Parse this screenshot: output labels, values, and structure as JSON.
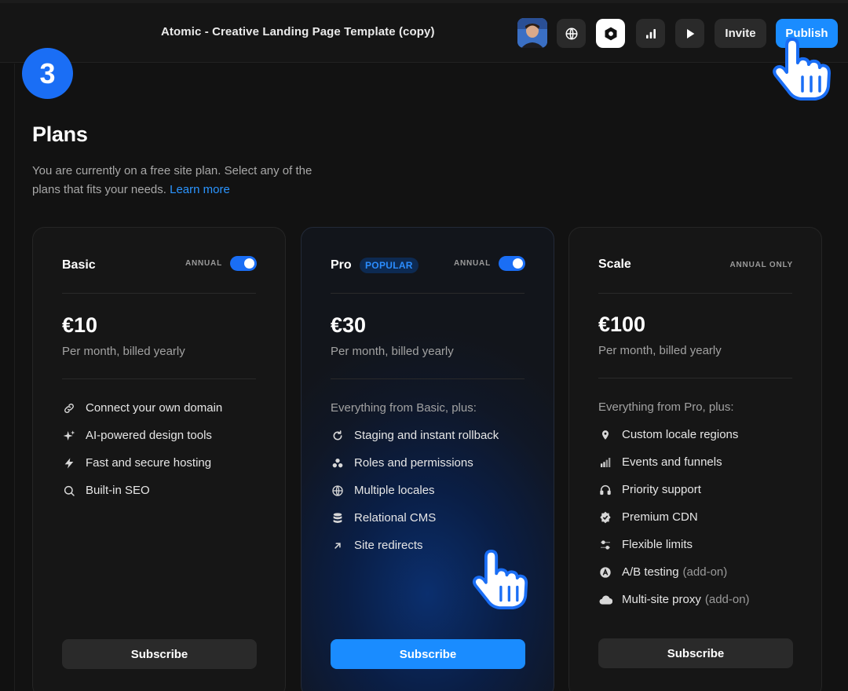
{
  "topbar": {
    "title": "Atomic - Creative Landing Page Template (copy)",
    "icons": [
      "avatar",
      "globe-icon",
      "hexagon-icon",
      "analytics-icon",
      "play-icon"
    ],
    "invite_label": "Invite",
    "publish_label": "Publish",
    "accent": "#1a8cff"
  },
  "step": {
    "number": "3",
    "color": "#1a6ef5"
  },
  "plans": {
    "title": "Plans",
    "description": "You are currently on a free site plan. Select any of the plans that fits your needs.",
    "learn_more": "Learn more"
  },
  "cards": [
    {
      "name": "Basic",
      "billing": "ANNUAL",
      "toggle_on": true,
      "price": "€10",
      "period": "Per month, billed yearly",
      "features": [
        {
          "icon": "link-icon",
          "label": "Connect your own domain"
        },
        {
          "icon": "sparkle-icon",
          "label": "AI-powered design tools"
        },
        {
          "icon": "bolt-icon",
          "label": "Fast and secure hosting"
        },
        {
          "icon": "search-icon",
          "label": "Built-in SEO"
        }
      ],
      "subscribe": "Subscribe"
    },
    {
      "name": "Pro",
      "badge": "POPULAR",
      "billing": "ANNUAL",
      "toggle_on": true,
      "price": "€30",
      "period": "Per month, billed yearly",
      "intro": "Everything from Basic, plus:",
      "features": [
        {
          "icon": "refresh-icon",
          "label": "Staging and instant rollback"
        },
        {
          "icon": "users-icon",
          "label": "Roles and permissions"
        },
        {
          "icon": "globe-icon",
          "label": "Multiple locales"
        },
        {
          "icon": "database-icon",
          "label": "Relational CMS"
        },
        {
          "icon": "arrow-up-right-icon",
          "label": "Site redirects"
        }
      ],
      "subscribe": "Subscribe"
    },
    {
      "name": "Scale",
      "billing": "ANNUAL ONLY",
      "price": "€100",
      "period": "Per month, billed yearly",
      "intro": "Everything from Pro, plus:",
      "features": [
        {
          "icon": "pin-icon",
          "label": "Custom locale regions"
        },
        {
          "icon": "bar-chart-icon",
          "label": "Events and funnels"
        },
        {
          "icon": "headphones-icon",
          "label": "Priority support"
        },
        {
          "icon": "badge-check-icon",
          "label": "Premium CDN"
        },
        {
          "icon": "sliders-icon",
          "label": "Flexible limits"
        },
        {
          "icon": "ab-test-icon",
          "label": "A/B testing",
          "addon": "(add-on)"
        },
        {
          "icon": "cloud-icon",
          "label": "Multi-site proxy",
          "addon": "(add-on)"
        }
      ],
      "subscribe": "Subscribe"
    }
  ]
}
